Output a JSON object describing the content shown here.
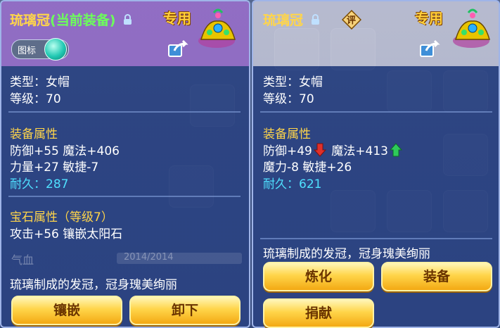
{
  "left_panel": {
    "item_name": "琉璃冠",
    "state": "(当前装备)",
    "exclusive": "专用",
    "toggle_label": "图标",
    "type_line": "类型：女帽",
    "level_line": "等级：70",
    "attr_header": "装备属性",
    "attr_line1": "防御+55 魔法+406",
    "attr_line2": "力量+27 敏捷-7",
    "durability_label": "耐久：",
    "durability_value": "287",
    "gem_header": "宝石属性（等级7）",
    "gem_line": "攻击+56 镶嵌太阳石",
    "bg_stat_label": "气血",
    "bg_stat_value": "2014/2014",
    "description": "琉璃制成的发冠，冠身瑰美绚丽",
    "buttons": [
      "镶嵌",
      "卸下"
    ]
  },
  "right_panel": {
    "item_name": "琉璃冠",
    "badge": "评",
    "exclusive": "专用",
    "type_line": "类型：女帽",
    "level_line": "等级：70",
    "attr_header": "装备属性",
    "attr_defense": "防御+49",
    "attr_magic": "魔法+413",
    "attr_line2": "魔力-8 敏捷+26",
    "durability_label": "耐久：",
    "durability_value": "621",
    "description": "琉璃制成的发冠，冠身瑰美绚丽",
    "buttons": [
      "炼化",
      "装备",
      "捐献"
    ]
  },
  "colors": {
    "gold": "#ffd54a",
    "equipped_green": "#6cff5a",
    "durability_cyan": "#4fe0ff",
    "arrow_down": "#e0302a",
    "arrow_up": "#2ecb5a"
  },
  "icons": [
    "lock-icon",
    "share-icon",
    "helmet-item-icon",
    "toggle-knob-icon",
    "arrow-down-icon",
    "arrow-up-icon"
  ]
}
